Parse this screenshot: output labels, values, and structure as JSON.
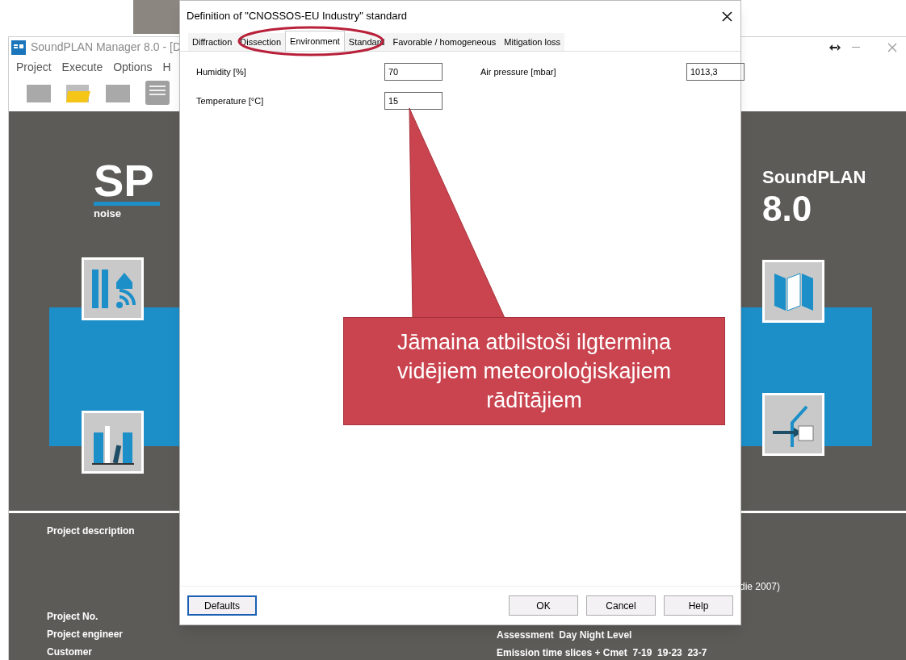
{
  "app": {
    "title": "SoundPLAN Manager 8.0 - [D",
    "menu": [
      "Project",
      "Execute",
      "Options",
      "H"
    ],
    "brand": {
      "logo_mark": "SP",
      "logo_caption": "noise",
      "product": "SoundPLAN",
      "version": "8.0"
    },
    "info_left": {
      "heading": "Project description",
      "fields": [
        "Project No.",
        "Project engineer",
        "Customer"
      ]
    },
    "info_right": {
      "note": "die 2007)",
      "lines": [
        "Assessment  Day Night Level",
        "Emission time slices + Cmet  7-19  19-23  23-7"
      ]
    }
  },
  "dialog": {
    "title": "Definition of \"CNOSSOS-EU Industry\" standard",
    "tabs": [
      {
        "label": "Diffraction",
        "selected": false
      },
      {
        "label": "Dissection",
        "selected": false
      },
      {
        "label": "Environment",
        "selected": true
      },
      {
        "label": "Standard",
        "selected": false
      },
      {
        "label": "Favorable / homogeneous",
        "selected": false
      },
      {
        "label": "Mitigation loss",
        "selected": false
      }
    ],
    "fields": [
      {
        "label": "Humidity [%]",
        "value": "70"
      },
      {
        "label": "Air pressure [mbar]",
        "value": "1013,3"
      },
      {
        "label": "Temperature [°C]",
        "value": "15"
      }
    ],
    "buttons": [
      {
        "label": "Defaults",
        "focused": true
      },
      {
        "label": "OK",
        "focused": false
      },
      {
        "label": "Cancel",
        "focused": false
      },
      {
        "label": "Help",
        "focused": false
      }
    ]
  },
  "annotation": {
    "text": "Jāmaina atbilstoši ilgtermiņa vidējiem meteoroloģiskajiem rādītājiem"
  }
}
